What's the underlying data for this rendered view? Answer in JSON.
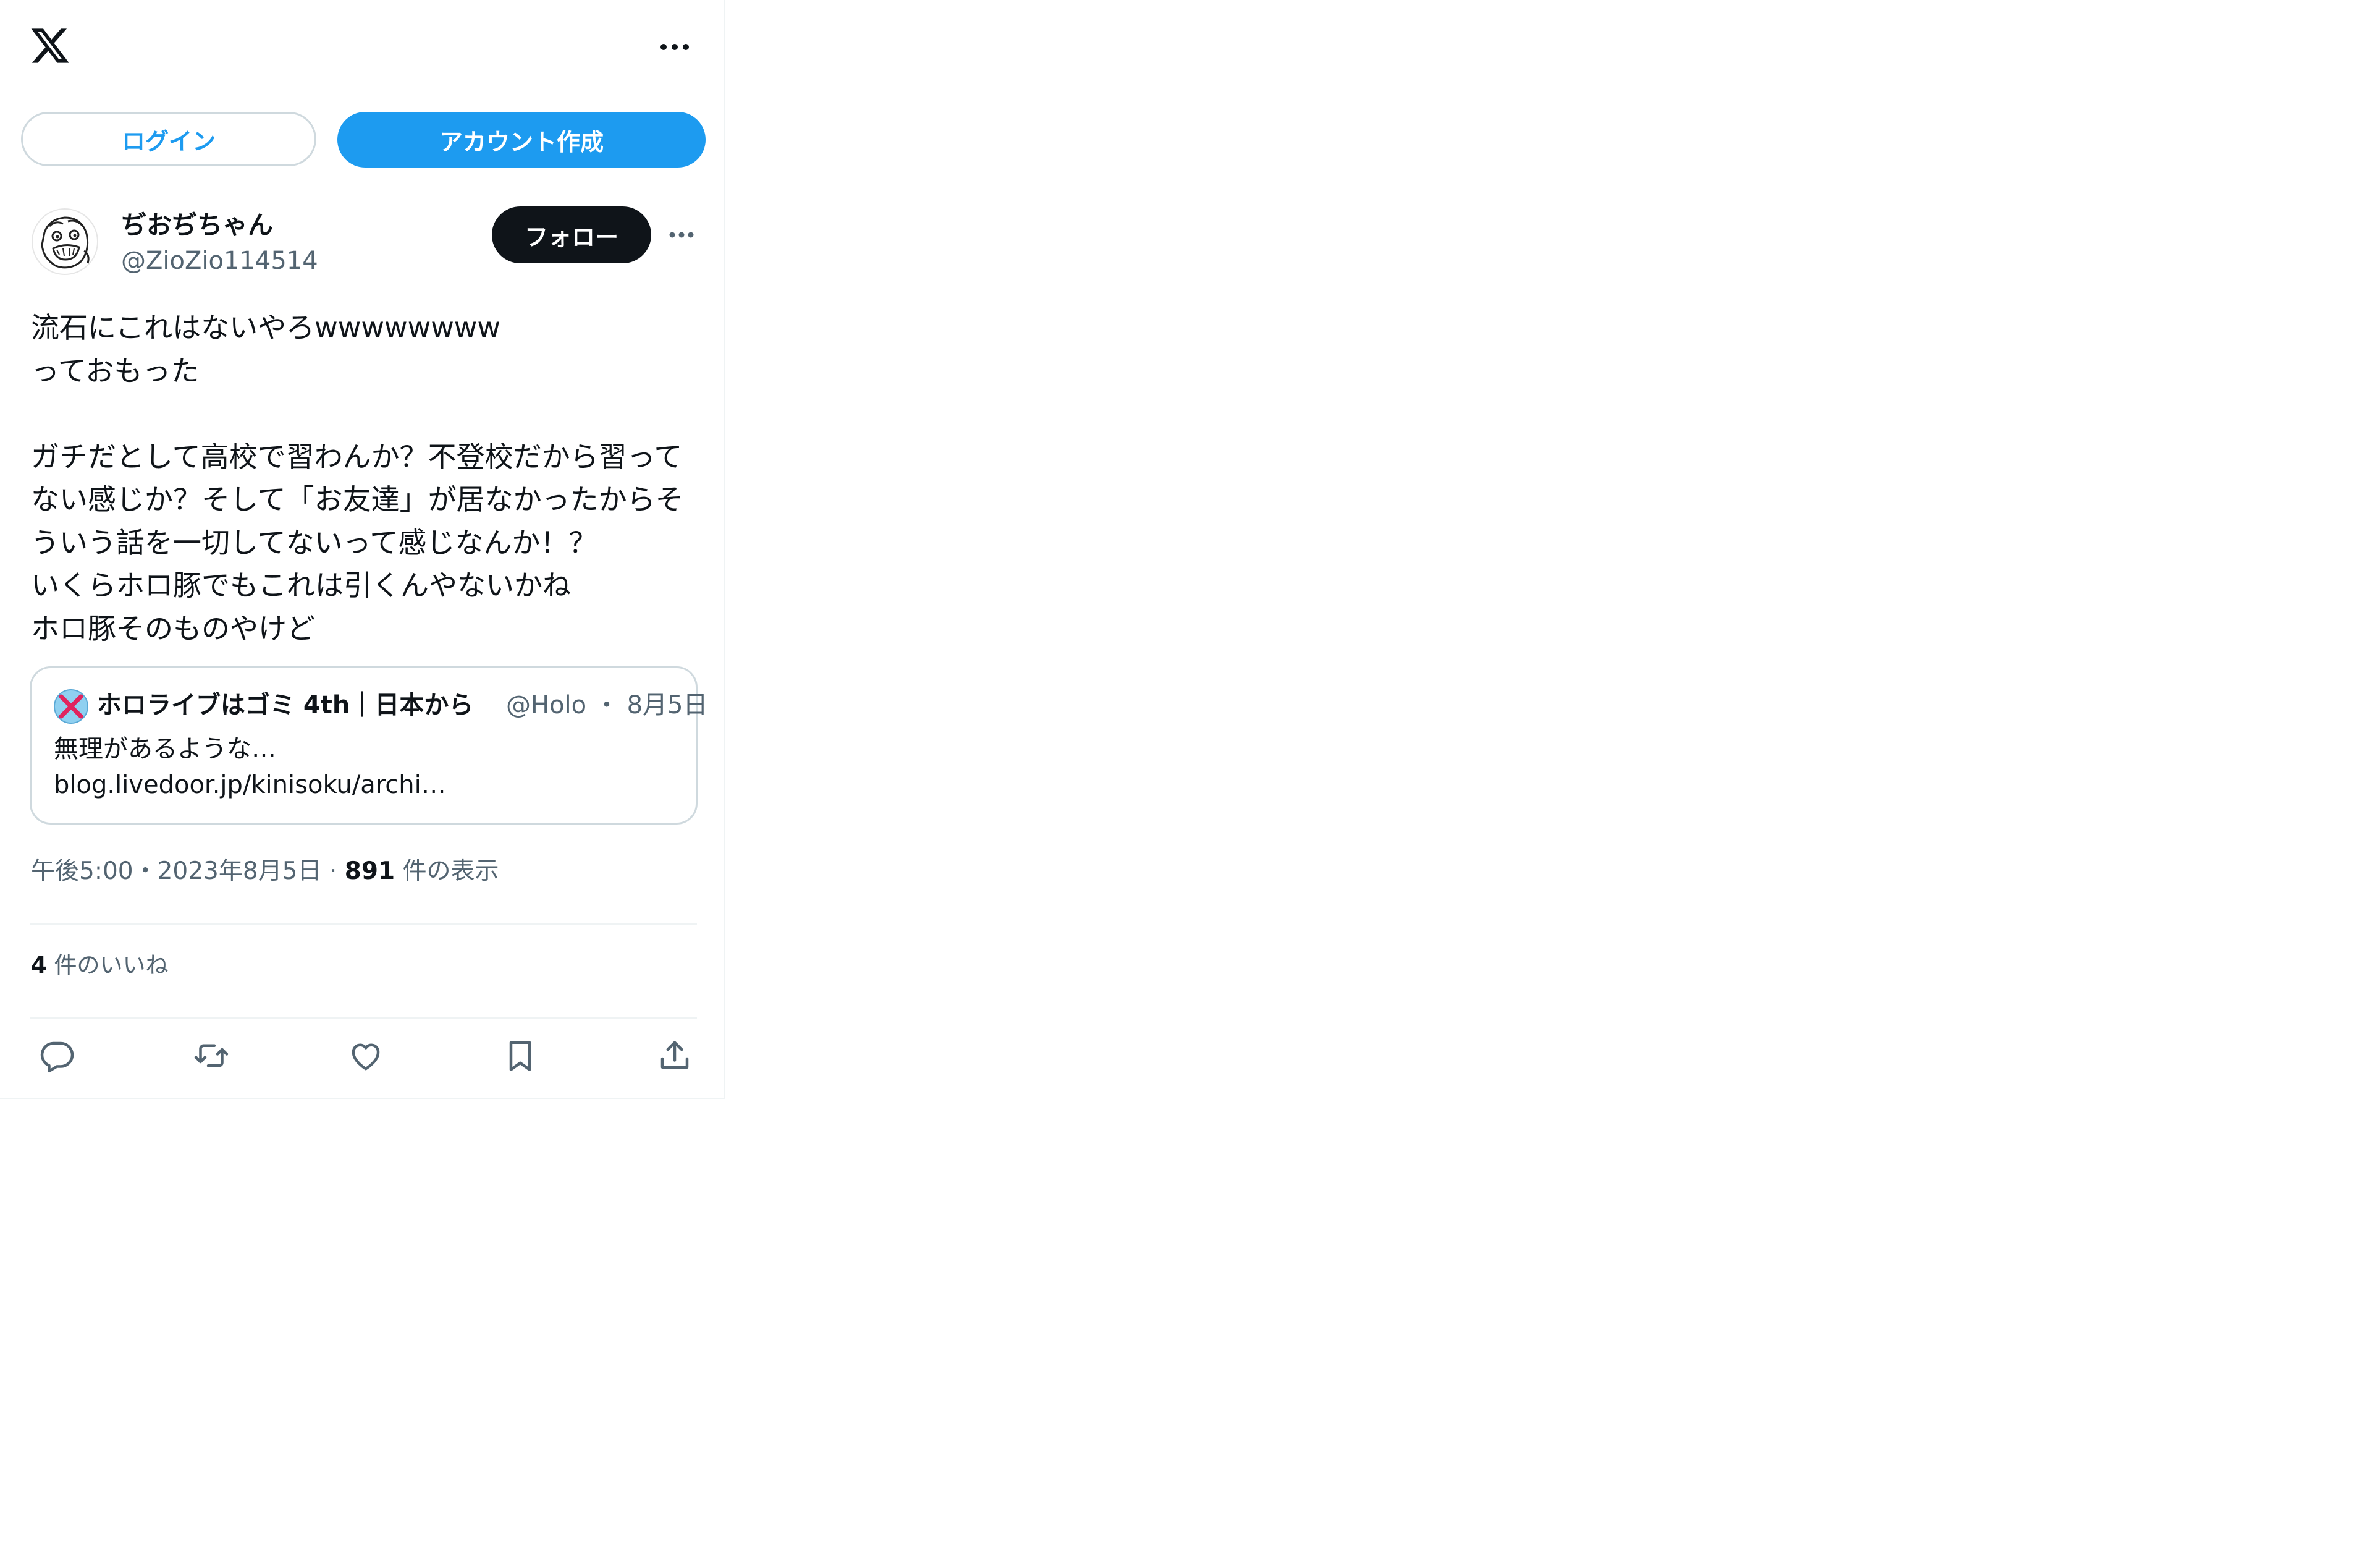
{
  "header": {
    "logo_icon": "x-logo-icon",
    "more_icon": "more-horizontal-icon"
  },
  "auth": {
    "login_label": "ログイン",
    "signup_label": "アカウント作成",
    "accent_color": "#1d9bf0"
  },
  "author": {
    "display_name": "ぢおぢちゃん",
    "handle": "@ZioZio114514",
    "follow_label": "フォロー",
    "more_icon": "more-horizontal-icon"
  },
  "tweet": {
    "text": "流石にこれはないやろwwwwwwww\nっておもった\n\nガチだとして高校で習わんか？不登校だから習ってない感じか？そして「お友達」が居なかったからそういう話を一切してないって感じなんか！？\nいくらホロ豚でもこれは引くんやないかね\nホロ豚そのものやけど"
  },
  "quote": {
    "display_name": "ホロライブはゴミ 4th｜日本から",
    "handle": "@Holo",
    "separator": "・",
    "date": "8月5日",
    "body_line1": "無理があるような…",
    "body_line2": "blog.livedoor.jp/kinisoku/archi…"
  },
  "meta": {
    "time": "午後5:00",
    "separator1": "・",
    "date": "2023年8月5日",
    "separator2": " · ",
    "views_count": "891",
    "views_label": " 件の表示"
  },
  "stats": {
    "likes_count": "4",
    "likes_label": " 件のいいね"
  },
  "actions": {
    "reply_icon": "reply-icon",
    "retweet_icon": "retweet-icon",
    "like_icon": "heart-icon",
    "bookmark_icon": "bookmark-icon",
    "share_icon": "share-icon",
    "icon_color": "#536471"
  }
}
